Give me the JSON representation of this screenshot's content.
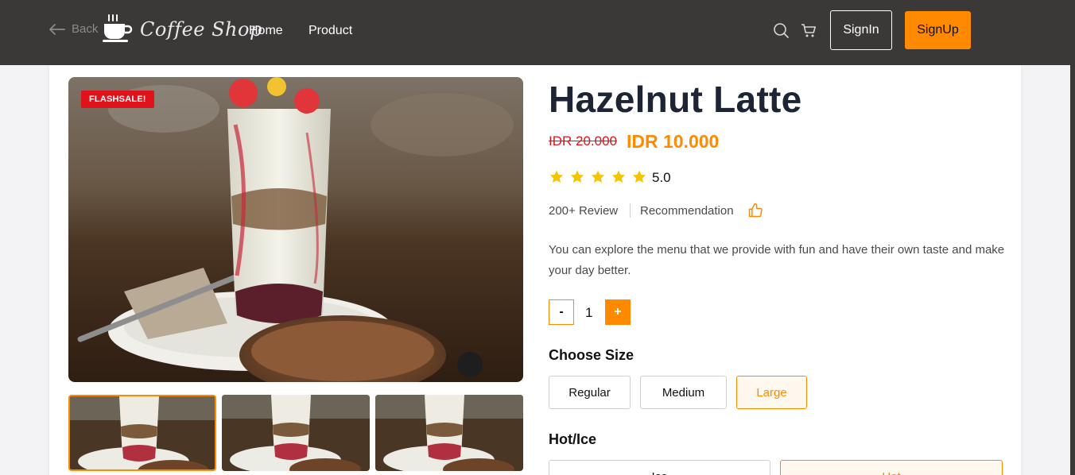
{
  "nav": {
    "back_label": "Back",
    "logo_text": "Coffee Shop",
    "links": [
      "Home",
      "Product"
    ],
    "signin_label": "SignIn",
    "signup_label": "SignUp"
  },
  "product": {
    "badge": "FLASHSALE!",
    "title": "Hazelnut Latte",
    "old_price": "IDR 20.000",
    "new_price": "IDR 10.000",
    "rating": "5.0",
    "stars": 5,
    "reviews": "200+ Review",
    "recommendation": "Recommendation",
    "description": "You can explore the menu that we provide with fun and have their own taste and make your day better.",
    "quantity": {
      "minus": "-",
      "value": "1",
      "plus": "+"
    },
    "size": {
      "title": "Choose Size",
      "options": [
        "Regular",
        "Medium",
        "Large"
      ],
      "selected": "Large"
    },
    "temperature": {
      "title": "Hot/Ice",
      "options": [
        "Ice",
        "Hot"
      ],
      "selected": "Hot"
    }
  },
  "colors": {
    "navbar": "#3b3838",
    "accent": "#ff8a00",
    "sale": "#e0131a",
    "star": "#f5c400",
    "title": "#1d2433"
  },
  "icons": [
    "arrow-left-icon",
    "coffee-cup-icon",
    "search-icon",
    "cart-icon",
    "star-icon",
    "thumbs-up-icon"
  ]
}
